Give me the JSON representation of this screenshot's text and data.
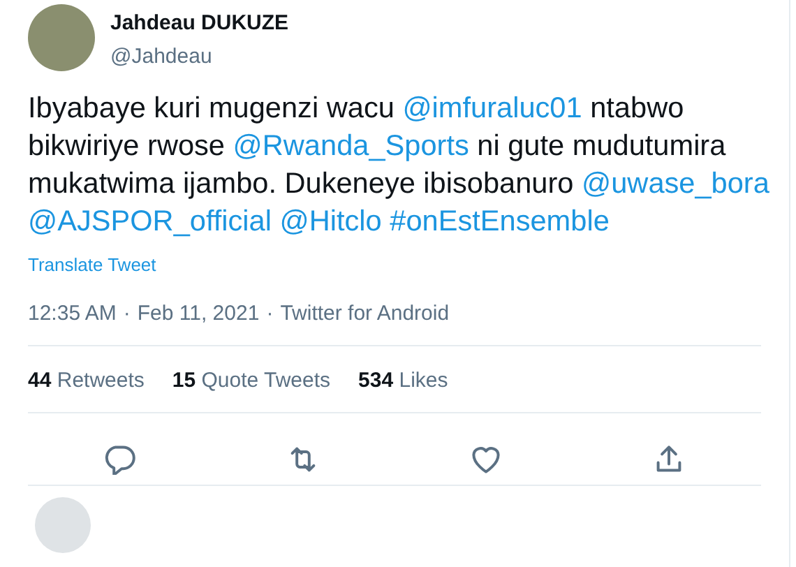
{
  "author": {
    "name": "Jahdeau DUKUZE",
    "handle": "@Jahdeau"
  },
  "tweet": [
    {
      "kind": "text",
      "text": "Ibyabaye kuri mugenzi wacu "
    },
    {
      "kind": "link",
      "text": "@imfuraluc01"
    },
    {
      "kind": "text",
      "text": " ntabwo bikwiriye rwose "
    },
    {
      "kind": "link",
      "text": "@Rwanda_Sports"
    },
    {
      "kind": "text",
      "text": " ni gute mudutumira mukatwima ijambo. Dukeneye ibisobanuro "
    },
    {
      "kind": "link",
      "text": "@uwase_bora"
    },
    {
      "kind": "link",
      "text": "@AJSPOR_official"
    },
    {
      "kind": "link",
      "text": "@Hitclo"
    },
    {
      "kind": "link",
      "text": "#onEstEnsemble"
    }
  ],
  "translate": "Translate Tweet",
  "meta": {
    "time": "12:35 AM",
    "date": "Feb 11, 2021",
    "separator": "·",
    "source": "Twitter for Android"
  },
  "stats": [
    {
      "count": "44",
      "label": "Retweets"
    },
    {
      "count": "15",
      "label": "Quote Tweets"
    },
    {
      "count": "534",
      "label": "Likes"
    }
  ],
  "actions": [
    {
      "kind": "reply"
    },
    {
      "kind": "retweet"
    },
    {
      "kind": "like"
    },
    {
      "kind": "share"
    }
  ]
}
